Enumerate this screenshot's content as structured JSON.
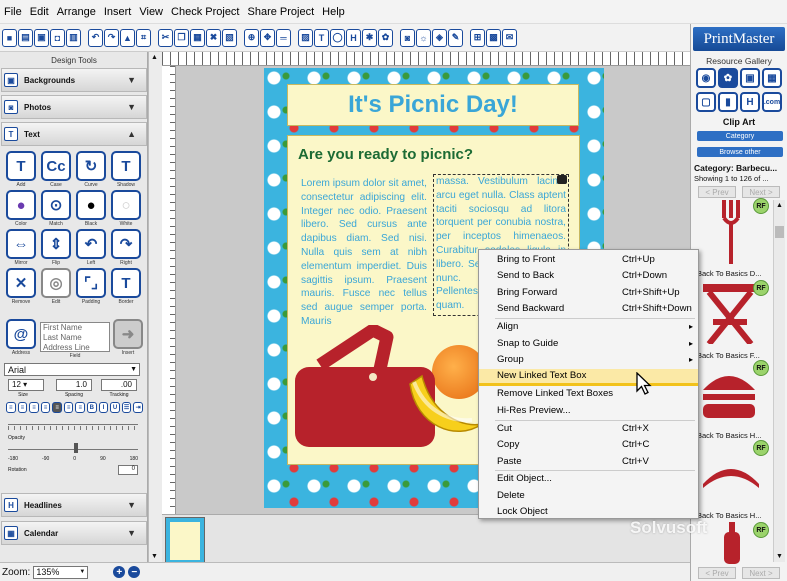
{
  "menubar": {
    "items": [
      "File",
      "Edit",
      "Arrange",
      "Insert",
      "View",
      "Check Project",
      "Share Project",
      "Help"
    ]
  },
  "left_panel": {
    "title": "Design Tools",
    "sections": {
      "backgrounds": "Backgrounds",
      "photos": "Photos",
      "text": "Text",
      "headlines": "Headlines",
      "calendar": "Calendar"
    },
    "text_tools": [
      "Add",
      "Case",
      "Curve",
      "Shadow",
      "Color",
      "Match",
      "Black",
      "White",
      "Mirror",
      "Flip",
      "Left",
      "Right",
      "Remove",
      "Edit",
      "Padding",
      "Border",
      "Address",
      "Field",
      "Insert"
    ],
    "field_list": [
      "First Name",
      "Last Name",
      "Address Line"
    ],
    "font": "Arial",
    "size": "12",
    "spacing": "1.0",
    "tracking": ".00",
    "size_label": "Size",
    "spacing_label": "Spacing",
    "tracking_label": "Tracking",
    "opacity_label": "Opacity",
    "rotation_label": "Rotation",
    "slider_ticks": [
      "-180",
      "-90",
      "0",
      "90",
      "180"
    ],
    "rotation_value": "0"
  },
  "document": {
    "title": "It's Picnic Day!",
    "subheading": "Are you ready to picnic?",
    "column1": "Lorem ipsum dolor sit amet, consectetur adipiscing elit. Integer nec odio. Praesent libero. Sed cursus ante dapibus diam. Sed nisi. Nulla quis sem at nibh elementum imperdiet. Duis sagittis ipsum. Praesent mauris. Fusce nec tellus sed augue semper porta. Mauris",
    "column2": "massa. Vestibulum lacinia arcu eget nulla. Class aptent taciti sociosqu ad litora torquent per conubia nostra, per inceptos himenaeos. Curabitur sodales ligula in libero. Sed dignissim lacinia nunc. Curabitur tortor. Pellentesque nibh. Aenean quam."
  },
  "status": {
    "zoom_label": "Zoom:",
    "zoom_value": "135%"
  },
  "right_panel": {
    "logo": "PrintMaster",
    "title": "Resource Gallery",
    "clip_art": "Clip Art",
    "category_btn": "Category",
    "browse_btn": "Browse other",
    "category": "Category: Barbecu...",
    "showing": "Showing 1 to 126 of ...",
    "prev": "< Prev",
    "next": "Next >",
    "badge": "RF",
    "items": [
      "Back To Basics D...",
      "Back To Basics F...",
      "Back To Basics H...",
      "Back To Basics H..."
    ]
  },
  "context_menu": {
    "items": [
      {
        "label": "Bring to Front",
        "shortcut": "Ctrl+Up"
      },
      {
        "label": "Send to Back",
        "shortcut": "Ctrl+Down"
      },
      {
        "label": "Bring Forward",
        "shortcut": "Ctrl+Shift+Up"
      },
      {
        "label": "Send Backward",
        "shortcut": "Ctrl+Shift+Down"
      },
      {
        "label": "Align",
        "shortcut": ""
      },
      {
        "label": "Snap to Guide",
        "shortcut": ""
      },
      {
        "label": "Group",
        "shortcut": ""
      },
      {
        "label": "New Linked Text Box",
        "shortcut": ""
      },
      {
        "label": "Remove Linked Text Boxes",
        "shortcut": ""
      },
      {
        "label": "Hi-Res Preview...",
        "shortcut": ""
      },
      {
        "label": "Cut",
        "shortcut": "Ctrl+X"
      },
      {
        "label": "Copy",
        "shortcut": "Ctrl+C"
      },
      {
        "label": "Paste",
        "shortcut": "Ctrl+V"
      },
      {
        "label": "Edit Object...",
        "shortcut": ""
      },
      {
        "label": "Delete",
        "shortcut": ""
      },
      {
        "label": "Lock Object",
        "shortcut": ""
      }
    ]
  },
  "watermark": "Solvusoft"
}
